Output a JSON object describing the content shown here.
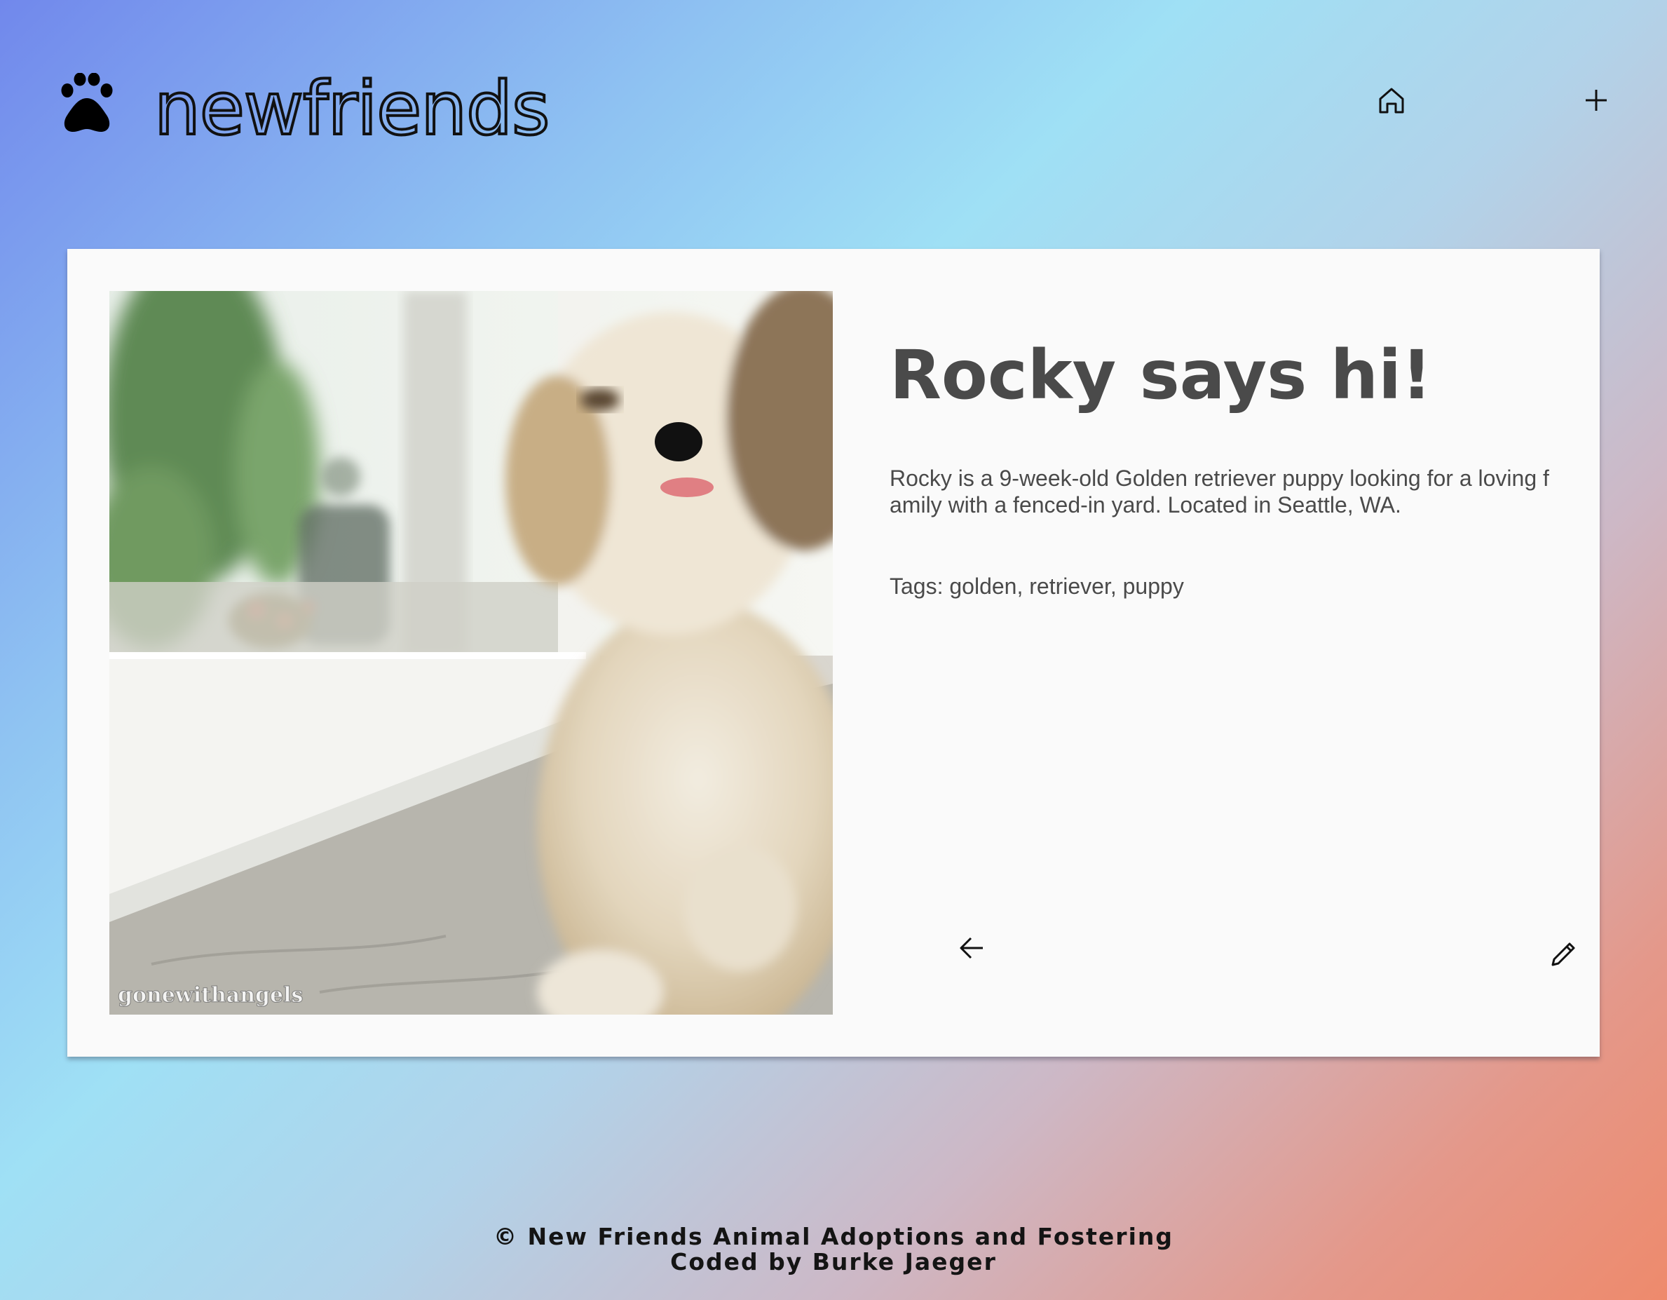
{
  "header": {
    "brand": "newfriends",
    "logo_icon": "paw-icon",
    "nav": [
      {
        "icon": "home-icon"
      },
      {
        "icon": "plus-icon"
      }
    ]
  },
  "pet": {
    "title": "Rocky says hi!",
    "description": "Rocky is a 9-week-old Golden retriever puppy looking for a loving family with a fenced-in yard. Located in Seattle, WA.",
    "tags": "Tags: golden, retriever, puppy",
    "photo_watermark": "gonewithangels"
  },
  "actions": {
    "back_icon": "arrow-left-icon",
    "edit_icon": "pencil-icon"
  },
  "footer": {
    "line1": "© New Friends Animal Adoptions and Fostering",
    "line2": "Coded by Burke Jaeger"
  },
  "colors": {
    "card_bg": "#fafafa",
    "text": "#4a4a4a",
    "gradient_start": "#7188ec",
    "gradient_mid": "#9fe0f5",
    "gradient_end": "#ee8a6c"
  }
}
